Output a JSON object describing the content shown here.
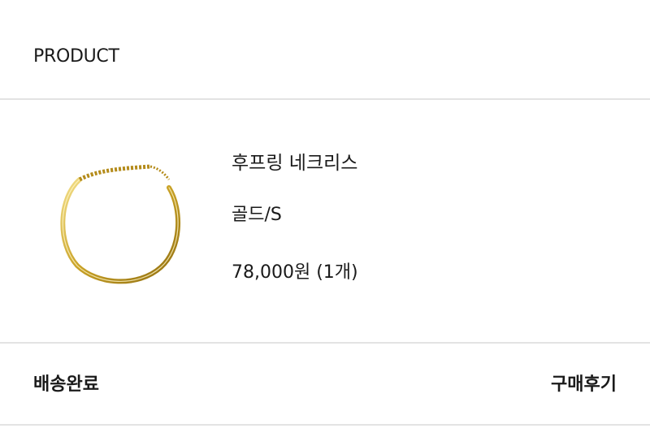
{
  "header": {
    "title": "PRODUCT"
  },
  "product": {
    "name": "후프링 네크리스",
    "option": "골드/S",
    "price": "78,000원 (1개)",
    "image_icon": "gold-hoop-necklace",
    "accent_color": "#c9a227"
  },
  "order": {
    "status": "배송완료",
    "review_label": "구매후기"
  }
}
